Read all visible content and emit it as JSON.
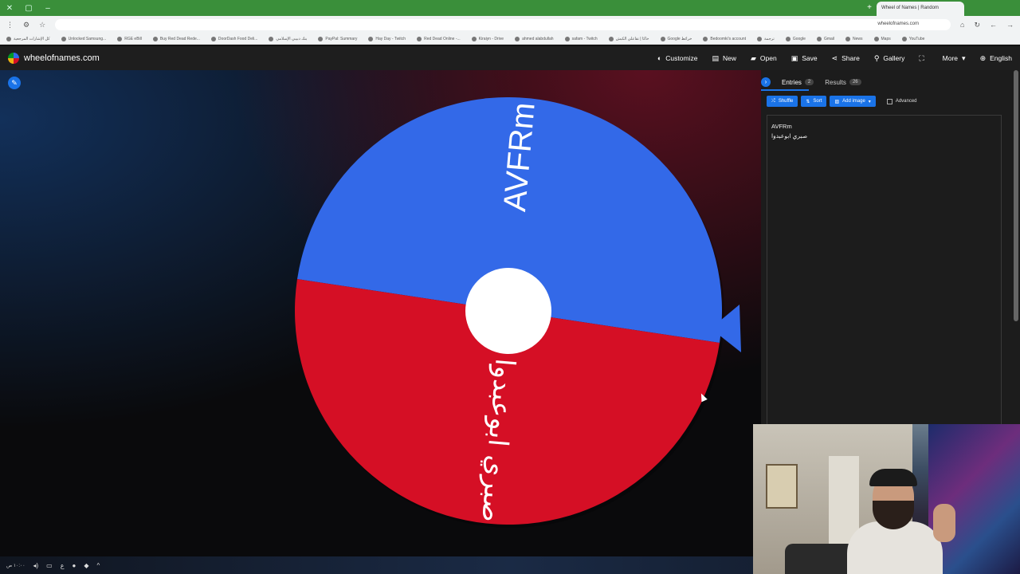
{
  "browser": {
    "tab_title": "Wheel of Names | Random",
    "url": "wheelofnames.com",
    "bookmarks": [
      "كل الإشارات المرجعية",
      "Unlocked Samsung...",
      "RGE eBill",
      "Buy Red Dead Rede...",
      "DoorDash Food Deli...",
      "بنك دبيبي الإسلامي",
      "PayPal: Summary",
      "Hay Day - Twitch",
      "Red Dead Online -...",
      "Kiraiyn - Drive",
      "ahmed alabdullah",
      "safam - Twitch",
      "خاكا | تقاعلي الكبش",
      "Google خرائط",
      "Bedoomki's account",
      "ترجمة",
      "Google",
      "Gmail",
      "News",
      "Maps",
      "YouTube"
    ]
  },
  "header": {
    "site_name": "wheelofnames.com",
    "nav": [
      {
        "label": "Customize",
        "icon": "palette-icon",
        "glyph": "◐"
      },
      {
        "label": "New",
        "icon": "new-file-icon",
        "glyph": "▤"
      },
      {
        "label": "Open",
        "icon": "folder-icon",
        "glyph": "▰"
      },
      {
        "label": "Save",
        "icon": "save-icon",
        "glyph": "▣"
      },
      {
        "label": "Share",
        "icon": "share-icon",
        "glyph": "⋖"
      },
      {
        "label": "Gallery",
        "icon": "search-icon",
        "glyph": "⚲"
      },
      {
        "label": "",
        "icon": "fullscreen-icon",
        "glyph": "⛶"
      },
      {
        "label": "More",
        "icon": "chevron-down-icon",
        "glyph": "▾"
      },
      {
        "label": "English",
        "icon": "globe-icon",
        "glyph": "⊕"
      }
    ]
  },
  "wheel": {
    "segments": [
      {
        "label": "AVFRm",
        "color": "#3369e8"
      },
      {
        "label": "صبري ابوعبدوا",
        "color": "#d50f25"
      }
    ]
  },
  "sidebar": {
    "tabs": [
      {
        "label": "Entries",
        "count": "2"
      },
      {
        "label": "Results",
        "count": "26"
      }
    ],
    "toolbar": {
      "shuffle": "Shuffle",
      "sort": "Sort",
      "add_image": "Add image",
      "advanced": "Advanced"
    },
    "entries": [
      "AVFRm",
      "صبري ابوعبدوا"
    ]
  },
  "taskbar": {
    "clock": "١٠:٠٠ ص"
  },
  "colors": {
    "accent": "#1a73e8",
    "wheel_blue": "#3369e8",
    "wheel_red": "#d50f25"
  }
}
